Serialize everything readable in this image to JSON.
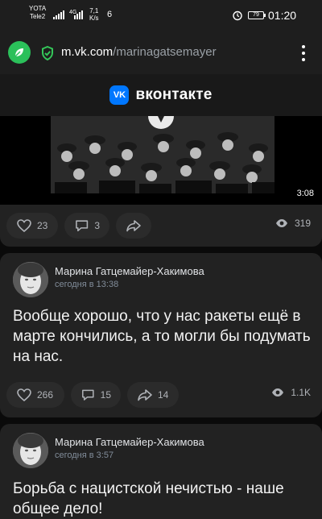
{
  "status_bar": {
    "carrier_top": "YOTA",
    "carrier_bottom": "Tele2",
    "net_top": "4G",
    "speed_value": "7,1",
    "speed_unit": "K/s",
    "extra": "6",
    "battery": "79",
    "time": "01:20"
  },
  "browser": {
    "url_host": "m.vk.com",
    "url_path": "/marinagatsemayer"
  },
  "vk": {
    "logo_text": "VK",
    "name": "вконтакте"
  },
  "video_post": {
    "duration": "3:08",
    "likes": "23",
    "comments": "3",
    "views": "319"
  },
  "post1": {
    "author": "Марина Гатцемайер-Хакимова",
    "time": "сегодня в 13:38",
    "text": "Вообще хорошо, что у нас ракеты ещё в марте кончились, а то могли бы подумать на нас.",
    "likes": "266",
    "comments": "15",
    "shares": "14",
    "views": "1.1K"
  },
  "post2": {
    "author": "Марина Гатцемайер-Хакимова",
    "time": "сегодня в 3:57",
    "text": "Борьба с нацистской нечистью - наше общее дело!"
  },
  "colors": {
    "accent": "#0077ff",
    "leaf": "#2bc05a",
    "shield": "#34c759"
  }
}
